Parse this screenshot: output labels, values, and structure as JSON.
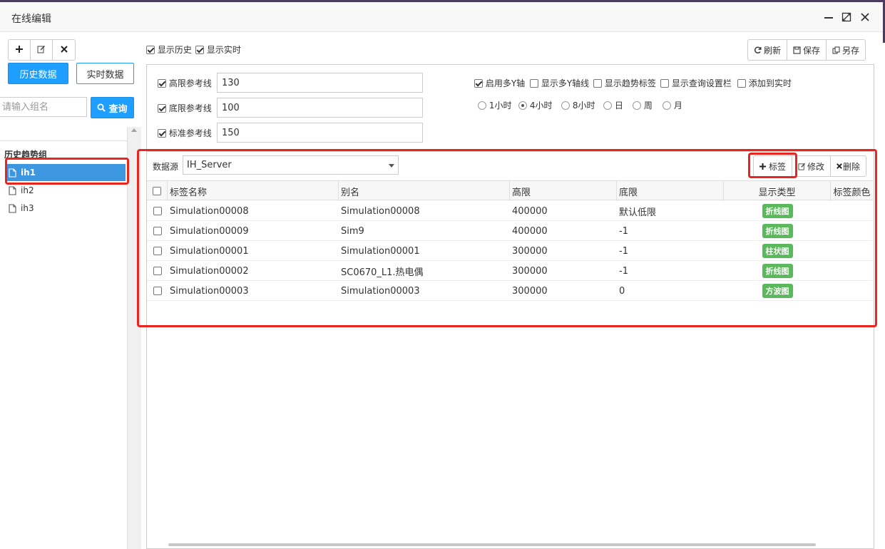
{
  "window": {
    "title": "在线编辑",
    "minimize_icon": "minimize-icon",
    "maximize_icon": "maximize-icon",
    "close_icon": "close-icon"
  },
  "left": {
    "add_icon": "plus-icon",
    "edit_icon": "edit-icon",
    "delete_icon": "x-icon",
    "history_button": "历史数据",
    "realtime_button": "实时数据",
    "group_placeholder": "请输入组名",
    "query_button": "查询",
    "list_header": "历史趋势组",
    "items": [
      {
        "label": "ih1",
        "active": true
      },
      {
        "label": "ih2",
        "active": false
      },
      {
        "label": "ih3",
        "active": false
      }
    ]
  },
  "top": {
    "show_history": {
      "label": "显示历史",
      "checked": true
    },
    "show_realtime": {
      "label": "显示实时",
      "checked": true
    },
    "refresh": "刷新",
    "save": "保存",
    "save_as": "另存"
  },
  "settings": {
    "high_ref": {
      "label": "高限参考线",
      "value": "130",
      "checked": true
    },
    "low_ref": {
      "label": "底限参考线",
      "value": "100",
      "checked": true
    },
    "std_ref": {
      "label": "标准参考线",
      "value": "150",
      "checked": true
    },
    "multi_y": {
      "label": "启用多Y轴",
      "checked": true
    },
    "show_multi_y": {
      "label": "显示多Y轴线",
      "checked": false
    },
    "show_trend_label": {
      "label": "显示趋势标签",
      "checked": false
    },
    "show_query_bar": {
      "label": "显示查询设置栏",
      "checked": false
    },
    "add_realtime": {
      "label": "添加到实时",
      "checked": false
    },
    "ranges": [
      {
        "label": "1小时",
        "selected": false
      },
      {
        "label": "4小时",
        "selected": true
      },
      {
        "label": "8小时",
        "selected": false
      },
      {
        "label": "日",
        "selected": false
      },
      {
        "label": "周",
        "selected": false
      },
      {
        "label": "月",
        "selected": false
      }
    ]
  },
  "datasource": {
    "label": "数据源",
    "value": "IH_Server",
    "add_tag": "标签",
    "modify": "修改",
    "delete": "删除"
  },
  "table": {
    "columns": [
      "标签名称",
      "别名",
      "高限",
      "底限",
      "显示类型",
      "标签颜色"
    ],
    "rows": [
      {
        "name": "Simulation00008",
        "alias": "Simulation00008",
        "high": "400000",
        "low": "默认低限",
        "type": "折线图"
      },
      {
        "name": "Simulation00009",
        "alias": "Sim9",
        "high": "400000",
        "low": "-1",
        "type": "折线图"
      },
      {
        "name": "Simulation00001",
        "alias": "Simulation00001",
        "high": "300000",
        "low": "-1",
        "type": "柱状图"
      },
      {
        "name": "Simulation00002",
        "alias": "SC0670_L1.热电偶",
        "high": "300000",
        "low": "-1",
        "type": "折线图"
      },
      {
        "name": "Simulation00003",
        "alias": "Simulation00003",
        "high": "300000",
        "low": "0",
        "type": "方波图"
      }
    ]
  },
  "colors": {
    "primary": "#1e9fff",
    "active_item": "#3c97e0",
    "badge": "#5cb85c",
    "highlight": "#e8251f"
  }
}
